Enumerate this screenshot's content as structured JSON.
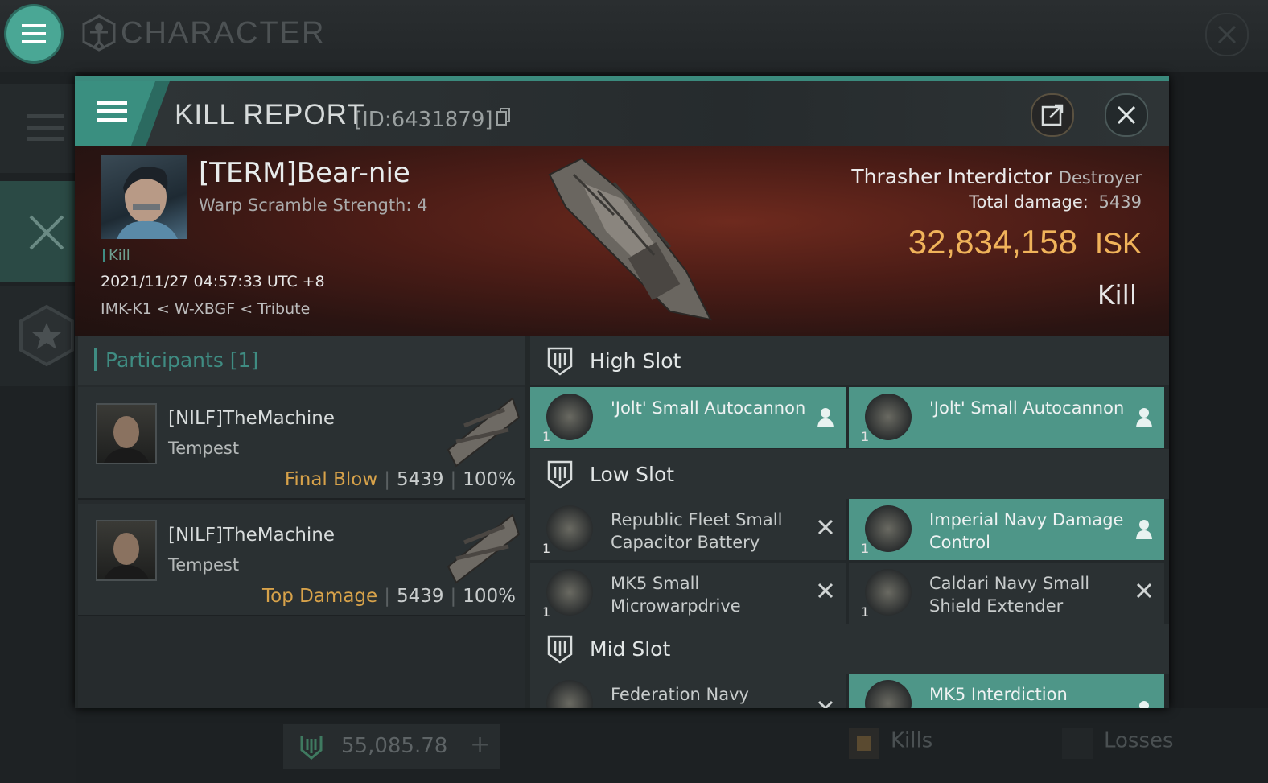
{
  "app": {
    "title": "CHARACTER"
  },
  "bottom": {
    "wallet": "55,085.78",
    "wallet_add": "+",
    "kills": "Kills",
    "losses": "Losses"
  },
  "report": {
    "title": "KILL REPORT",
    "id": "[ID:6431879]",
    "victim": {
      "name": "[TERM]Bear-nie",
      "scramble": "Warp Scramble Strength: 4",
      "tag": "Kill",
      "timestamp": "2021/11/27 04:57:33 UTC +8",
      "location": "IMK-K1 < W-XBGF < Tribute"
    },
    "ship": {
      "name": "Thrasher Interdictor",
      "class": "Destroyer",
      "damage_label": "Total damage:",
      "damage": "5439",
      "isk_value": "32,834,158",
      "isk_unit": "ISK",
      "result": "Kill"
    },
    "participants": {
      "title": "Participants [1]",
      "rows": [
        {
          "name": "[NILF]TheMachine",
          "ship": "Tempest",
          "label": "Final Blow",
          "damage": "5439",
          "percent": "100%"
        },
        {
          "name": "[NILF]TheMachine",
          "ship": "Tempest",
          "label": "Top Damage",
          "damage": "5439",
          "percent": "100%"
        }
      ]
    },
    "slots": {
      "high": {
        "label": "High Slot",
        "items": [
          {
            "qty": "1",
            "name": "'Jolt' Small Autocannon",
            "state": "dropped",
            "status_icon": "person-icon"
          },
          {
            "qty": "1",
            "name": "'Jolt' Small Autocannon",
            "state": "dropped",
            "status_icon": "person-icon"
          }
        ]
      },
      "low": {
        "label": "Low Slot",
        "items": [
          {
            "qty": "1",
            "name": "Republic Fleet Small Capacitor Battery",
            "state": "destroyed",
            "status_icon": "x-icon"
          },
          {
            "qty": "1",
            "name": "Imperial Navy Damage Control",
            "state": "dropped",
            "status_icon": "person-icon"
          },
          {
            "qty": "1",
            "name": "MK5 Small Microwarpdrive",
            "state": "destroyed",
            "status_icon": "x-icon"
          },
          {
            "qty": "1",
            "name": "Caldari Navy Small Shield Extender",
            "state": "destroyed",
            "status_icon": "x-icon"
          }
        ]
      },
      "mid": {
        "label": "Mid Slot",
        "items": [
          {
            "name": "Federation Navy",
            "state": "destroyed",
            "status_icon": "x-icon"
          },
          {
            "name": "MK5 Interdiction",
            "state": "dropped",
            "status_icon": "person-icon"
          }
        ]
      }
    }
  },
  "colors": {
    "accent": "#4aa795",
    "isk": "#f0b35a",
    "dropped": "#4e9688",
    "label_gold": "#d7a24a"
  }
}
